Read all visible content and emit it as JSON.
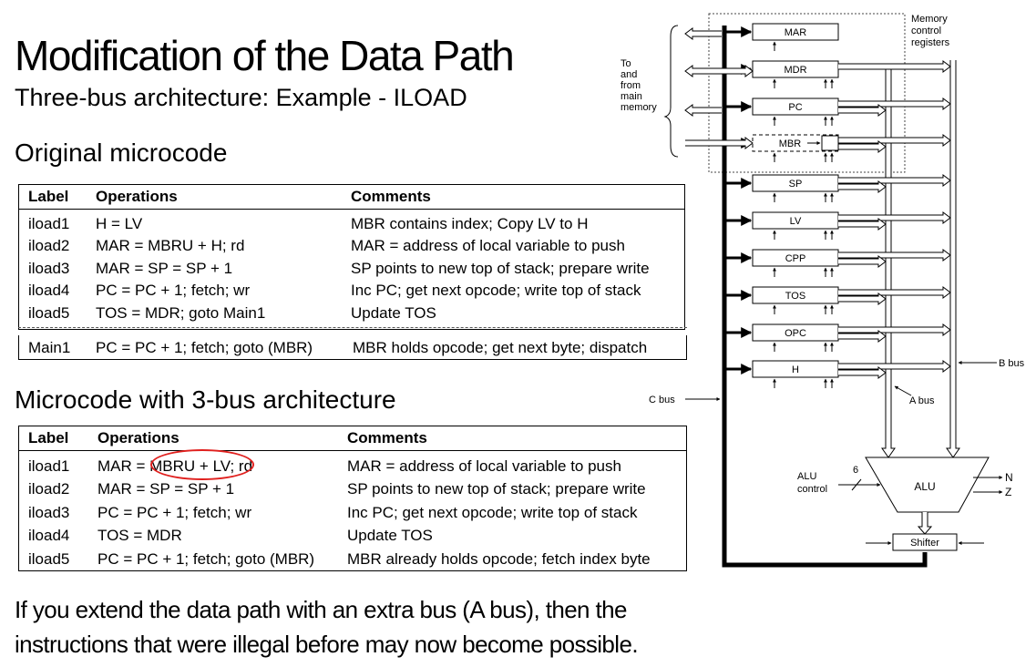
{
  "slide": {
    "title": "Modification of the Data Path",
    "subtitle": "Three-bus architecture: Example - ILOAD",
    "original_heading": "Original microcode",
    "new_heading": "Microcode with 3-bus architecture",
    "footer_line1": "If you extend the data path with an extra bus (A bus), then the",
    "footer_line2": "instructions that were illegal before may now become possible."
  },
  "original_table": {
    "headers": {
      "label": "Label",
      "operations": "Operations",
      "comments": "Comments"
    },
    "rows": [
      {
        "label": "iload1",
        "operations": "H = LV",
        "comments": "MBR contains index; Copy LV to H"
      },
      {
        "label": "iload2",
        "operations": "MAR = MBRU + H; rd",
        "comments": "MAR = address of local variable to push"
      },
      {
        "label": "iload3",
        "operations": "MAR = SP = SP + 1",
        "comments": "SP points to new top of stack; prepare write"
      },
      {
        "label": "iload4",
        "operations": "PC = PC + 1; fetch; wr",
        "comments": "Inc PC; get next opcode; write top of stack"
      },
      {
        "label": "iload5",
        "operations": "TOS = MDR; goto Main1",
        "comments": "Update TOS"
      }
    ],
    "main1": {
      "label": "Main1",
      "operations": "PC = PC + 1; fetch; goto (MBR)",
      "comments": "MBR holds opcode; get next byte; dispatch"
    }
  },
  "new_table": {
    "headers": {
      "label": "Label",
      "operations": "Operations",
      "comments": "Comments"
    },
    "rows": [
      {
        "label": "iload1",
        "operations": "MAR = MBRU + LV; rd",
        "comments": "MAR = address of local variable to push"
      },
      {
        "label": "iload2",
        "operations": "MAR = SP = SP + 1",
        "comments": "SP points to new top of stack; prepare write"
      },
      {
        "label": "iload3",
        "operations": "PC = PC + 1; fetch; wr",
        "comments": "Inc PC; get next opcode; write top of stack"
      },
      {
        "label": "iload4",
        "operations": "TOS = MDR",
        "comments": "Update TOS"
      },
      {
        "label": "iload5",
        "operations": "PC = PC + 1; fetch; goto (MBR)",
        "comments": "MBR already holds opcode; fetch index byte"
      }
    ],
    "highlight_color": "#e0201e"
  },
  "diagram": {
    "registers": [
      "MAR",
      "MDR",
      "PC",
      "MBR",
      "SP",
      "LV",
      "CPP",
      "TOS",
      "OPC",
      "H"
    ],
    "memory_note": [
      "To",
      "and",
      "from",
      "main",
      "memory"
    ],
    "mem_ctrl_label": [
      "Memory",
      "control",
      "registers"
    ],
    "c_bus": "C bus",
    "b_bus": "B bus",
    "a_bus": "A bus",
    "alu": "ALU",
    "alu_control": [
      "ALU",
      "control"
    ],
    "alu_ctrl_width": "6",
    "flag_n": "N",
    "flag_z": "Z",
    "shifter": "Shifter"
  }
}
